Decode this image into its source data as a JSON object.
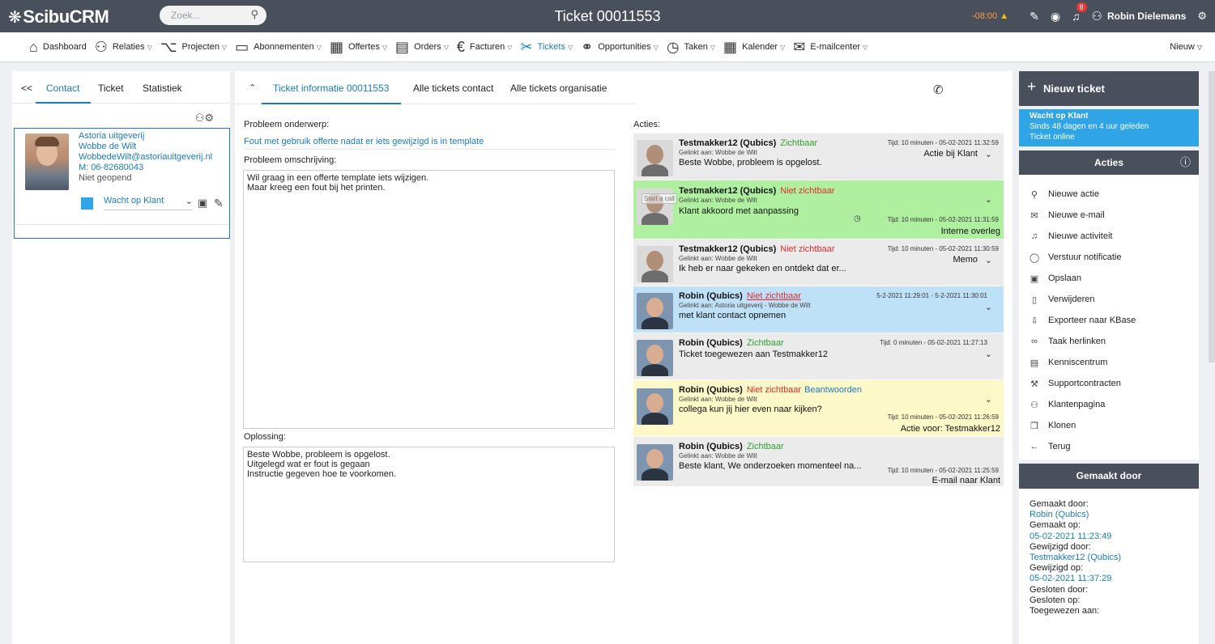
{
  "topbar": {
    "logo": "ScibuCRM",
    "search_placeholder": "Zoek...",
    "title": "Ticket 00011553",
    "time_warning": "-08:00",
    "notification_count": "8",
    "user_name": "Robin Dielemans"
  },
  "nav": {
    "items": [
      {
        "label": "Dashboard",
        "icon": "home-icon"
      },
      {
        "label": "Relaties",
        "icon": "user-icon"
      },
      {
        "label": "Projecten",
        "icon": "network-icon"
      },
      {
        "label": "Abonnementen",
        "icon": "folder-icon"
      },
      {
        "label": "Offertes",
        "icon": "calculator-icon"
      },
      {
        "label": "Orders",
        "icon": "clipboard-icon"
      },
      {
        "label": "Facturen",
        "icon": "euro-icon"
      },
      {
        "label": "Tickets",
        "icon": "tools-icon"
      },
      {
        "label": "Opportunities",
        "icon": "handshake-icon"
      },
      {
        "label": "Taken",
        "icon": "clock-icon"
      },
      {
        "label": "Kalender",
        "icon": "calendar-icon"
      },
      {
        "label": "E-mailcenter",
        "icon": "mail-icon"
      }
    ],
    "active": "Tickets",
    "new_label": "Nieuw"
  },
  "left": {
    "collapse": "<<",
    "tabs": [
      "Contact",
      "Ticket",
      "Statistiek"
    ],
    "contact": {
      "org": "Astoria uitgeverij",
      "name": "Wobbe de Wilt",
      "email": "WobbedeWilt@astoriauitgeverij.nl",
      "phone": "M: 06-82680043",
      "opened": "Niet geopend",
      "status": "Wacht op Klant",
      "status_color": "#2fa4e7"
    }
  },
  "middle": {
    "tabs": [
      "Ticket informatie 00011553",
      "Alle tickets contact",
      "Alle tickets organisatie"
    ],
    "subject_label": "Probleem onderwerp:",
    "subject": "Fout met gebruik offerte nadat er iets gewijzigd is in template",
    "description_label": "Probleem omschrijving:",
    "description": "Wil graag in een offerte template iets wijzigen.\nMaar kreeg een fout bij het printen.",
    "solution_label": "Oplossing:",
    "solution": "Beste Wobbe, probleem is opgelost.\nUitgelegd wat er fout is gegaan\nInstructie gegeven hoe te voorkomen.",
    "acties_label": "Acties:"
  },
  "actions": [
    {
      "who": "Testmakker12 (Qubics)",
      "visibility": "Zichtbaar",
      "linked": "Gelinkt aan: Wobbe de Wilt",
      "message": "Beste Wobbe, probleem is opgelost.",
      "time": "Tijd: 10 minuten - 05-02-2021 11:32:59",
      "tag": "Actie bij Klant",
      "bg": "#ebebeb"
    },
    {
      "who": "Testmakker12 (Qubics)",
      "visibility": "Niet zichtbaar",
      "linked": "Gelinkt aan: Wobbe de Wilt",
      "message": "Klant akkoord met aanpassing",
      "time": "Tijd: 10 minuten - 05-02-2021 11:31:59",
      "tag": "Interne overleg",
      "bg": "#aef0a0",
      "overlay": "Start a call"
    },
    {
      "who": "Testmakker12 (Qubics)",
      "visibility": "Niet zichtbaar",
      "linked": "Gelinkt aan: Wobbe de Wilt",
      "message": "Ik heb er naar gekeken en ontdekt dat er...",
      "time": "Tijd: 10 minuten - 05-02-2021 11:30:59",
      "tag": "Memo",
      "bg": "#ebebeb"
    },
    {
      "who": "Robin (Qubics)",
      "visibility": "Niet zichtbaar",
      "linked": "Gelinkt aan: Astoria uitgeverij - Wobbe de Wilt",
      "message": "met klant contact opnemen",
      "time": "5-2-2021 11:29:01 - 5-2-2021 11:30:01",
      "tag": "",
      "bg": "#bfe1f8"
    },
    {
      "who": "Robin (Qubics)",
      "visibility": "Zichtbaar",
      "linked": "",
      "message": "Ticket toegewezen aan Testmakker12",
      "time": "Tijd: 0 minuten - 05-02-2021 11:27:13",
      "tag": "",
      "bg": "#ebebeb"
    },
    {
      "who": "Robin (Qubics)",
      "visibility": "Niet zichtbaar",
      "reply": "Beantwoorden",
      "linked": "Gelinkt aan: Wobbe de Wilt",
      "message": "collega kun jij hier even naar kijken?",
      "time": "Tijd: 10 minuten - 05-02-2021 11:26:59",
      "tag": "Actie voor: Testmakker12",
      "bg": "#fdf8c8"
    },
    {
      "who": "Robin (Qubics)",
      "visibility": "Zichtbaar",
      "linked": "Gelinkt aan: Wobbe de Wilt",
      "message": "Beste klant, We onderzoeken momenteel na...",
      "time": "Tijd: 10 minuten - 05-02-2021 11:25:59",
      "tag": "E-mail naar Klant",
      "bg": "#ebebeb"
    }
  ],
  "right": {
    "new_ticket": "Nieuw ticket",
    "status_title": "Wacht op Klant",
    "status_since": "Sinds 48 dagen en 4 uur geleden",
    "status_online": "Ticket online",
    "acties_title": "Acties",
    "acties": [
      {
        "label": "Nieuwe actie",
        "icon": "pin-icon"
      },
      {
        "label": "Nieuwe e-mail",
        "icon": "mail-icon"
      },
      {
        "label": "Nieuwe activiteit",
        "icon": "bell-icon"
      },
      {
        "label": "Verstuur notificatie",
        "icon": "chat-icon"
      },
      {
        "label": "Opslaan",
        "icon": "save-icon"
      },
      {
        "label": "Verwijderen",
        "icon": "trash-icon"
      },
      {
        "label": "Exporteer naar KBase",
        "icon": "export-icon"
      },
      {
        "label": "Taak herlinken",
        "icon": "link-icon"
      },
      {
        "label": "Kenniscentrum",
        "icon": "book-icon"
      },
      {
        "label": "Supportcontracten",
        "icon": "wrench-icon"
      },
      {
        "label": "Klantenpagina",
        "icon": "users-icon"
      },
      {
        "label": "Klonen",
        "icon": "copy-icon"
      },
      {
        "label": "Terug",
        "icon": "arrow-left-icon"
      }
    ],
    "made_title": "Gemaakt door",
    "made": {
      "made_by_label": "Gemaakt door:",
      "made_by": "Robin (Qubics)",
      "made_on_label": "Gemaakt op:",
      "made_on": "05-02-2021 11:23:49",
      "changed_by_label": "Gewijzigd door:",
      "changed_by": "Testmakker12 (Qubics)",
      "changed_on_label": "Gewijzigd op:",
      "changed_on": "05-02-2021 11:37:29",
      "closed_by_label": "Gesloten door:",
      "closed_on_label": "Gesloten op:",
      "assigned_label": "Toegewezen aan:"
    }
  }
}
